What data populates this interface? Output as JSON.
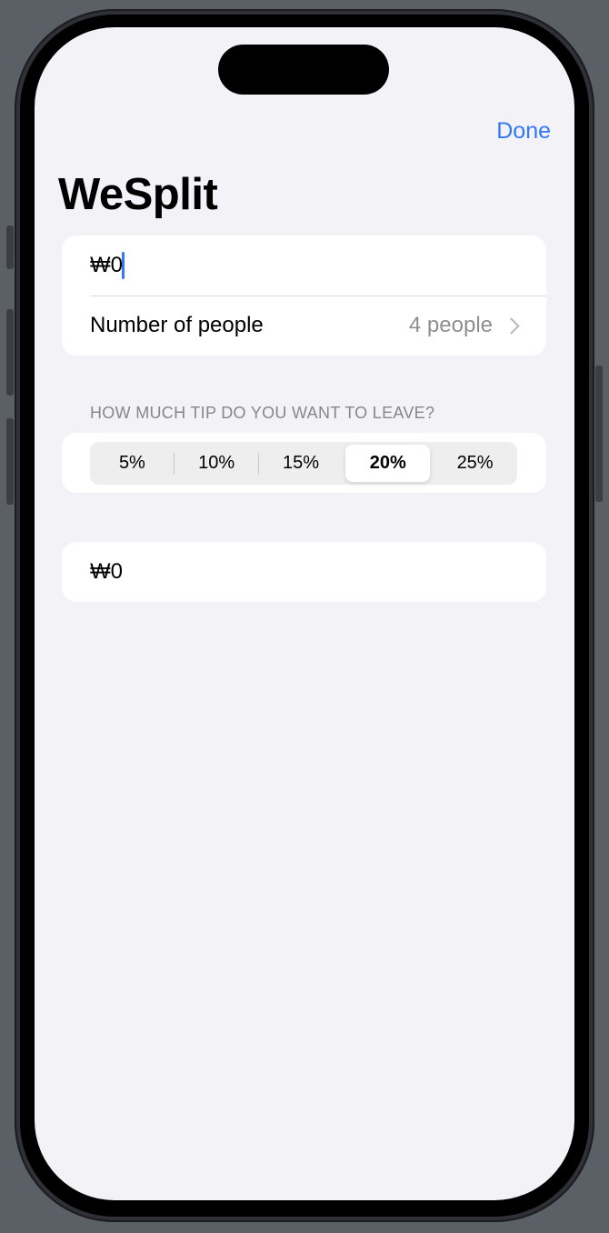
{
  "toolbar": {
    "done_label": "Done"
  },
  "page": {
    "title": "WeSplit"
  },
  "form": {
    "amount_value": "₩0",
    "people_label": "Number of people",
    "people_value": "4 people"
  },
  "tip": {
    "header": "HOW MUCH TIP DO YOU WANT TO LEAVE?",
    "options": [
      "5%",
      "10%",
      "15%",
      "20%",
      "25%"
    ],
    "selected": "20%"
  },
  "total": {
    "value": "₩0"
  },
  "colors": {
    "accent": "#3478f6",
    "background": "#f2f2f7",
    "secondary_text": "#8e8e93"
  },
  "icons": {
    "people_chevron": "chevron-right-icon"
  }
}
